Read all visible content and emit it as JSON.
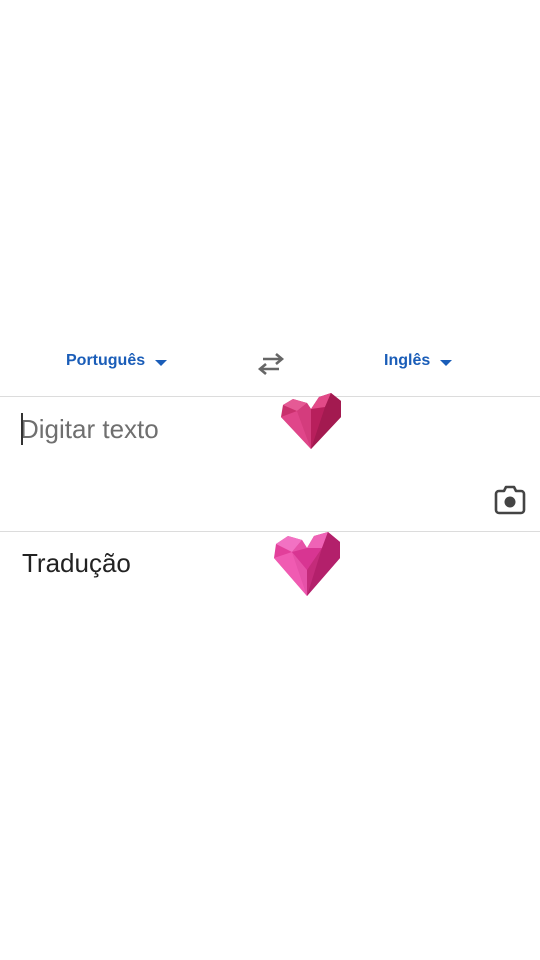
{
  "language_bar": {
    "source_language": "Português",
    "target_language": "Inglês"
  },
  "input": {
    "placeholder": "Digitar texto",
    "value": ""
  },
  "output": {
    "label": "Tradução"
  },
  "icons": {
    "swap": "swap-arrows-icon",
    "camera": "camera-icon",
    "dropdown": "caret-down-icon",
    "sticker": "heart-sticker"
  },
  "colors": {
    "accent": "#1a5db8",
    "divider": "#dcdcdc",
    "heart_primary": "#d6347f",
    "heart_secondary": "#e84fb6"
  }
}
